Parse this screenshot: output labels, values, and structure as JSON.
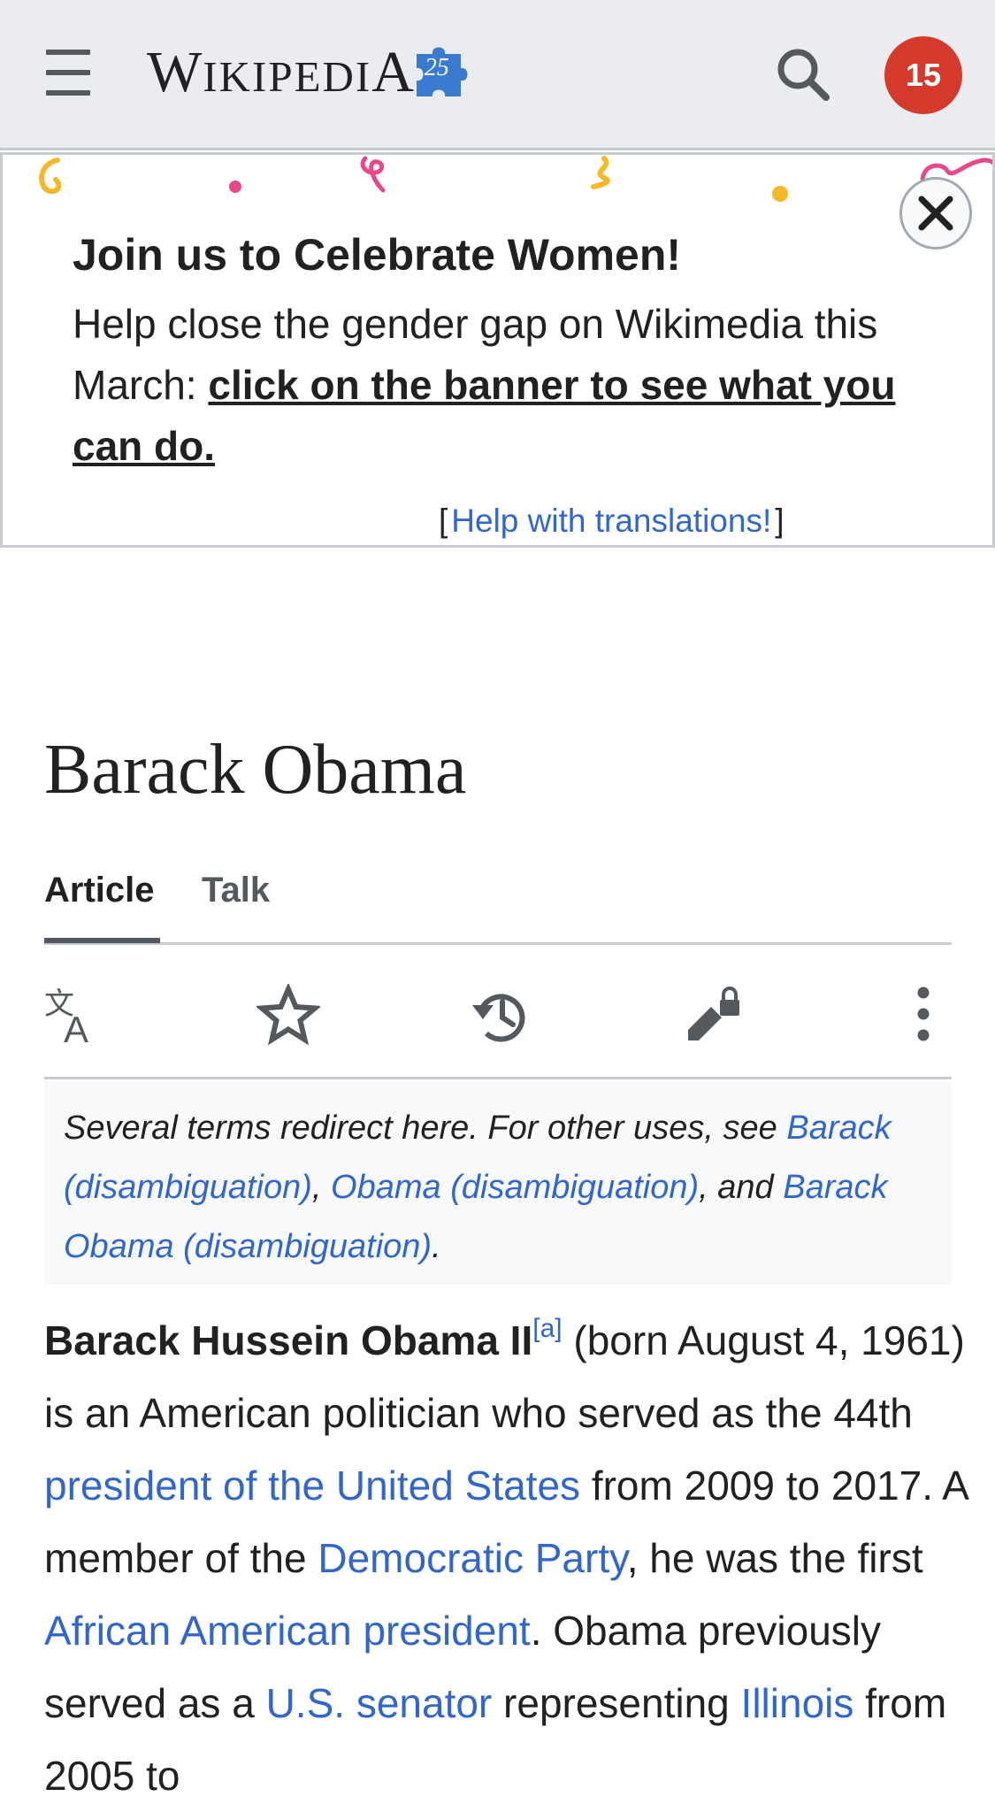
{
  "header": {
    "wordmark_initial": "W",
    "wordmark_rest": "IKIPEDI",
    "wordmark_final": "A",
    "anniversary_number": "25",
    "notification_count": "15"
  },
  "banner": {
    "title": "Join us to Celebrate Women!",
    "text": "Help close the gender gap on Wikimedia this March:",
    "link": "click on the banner to see what you can do.",
    "help_open": "[",
    "help_link": "Help with translations!",
    "help_close": "]"
  },
  "article": {
    "title": "Barack Obama",
    "tabs": [
      {
        "label": "Article",
        "selected": true
      },
      {
        "label": "Talk",
        "selected": false
      }
    ],
    "toolbar_icons": [
      "language-icon",
      "watch-star-icon",
      "history-icon",
      "edit-lock-icon",
      "more-icon"
    ],
    "hatnote": {
      "lead": "Several terms redirect here. For other uses, see",
      "link1": "Barack (disambiguation)",
      "sep1": ",",
      "link2": "Obama (disambiguation)",
      "sep2": ",",
      "and": "and",
      "link3": "Barack Obama (disambiguation)",
      "end": "."
    },
    "lead": {
      "name": "Barack Hussein Obama II",
      "footnote": "[a]",
      "t1": "(born August 4, 1961) is an American politician who served as the 44th",
      "l1": "president of the United States",
      "t2": "from 2009 to 2017. A member of the",
      "l2": "Democratic Party",
      "t3": ", he was the first",
      "l3": "African American president",
      "t4": ". Obama previously served as a",
      "l4": "U.S. senator",
      "t5": "representing",
      "l5": "Illinois",
      "t6": "from 2005 to"
    }
  },
  "colors": {
    "link": "#3366cc",
    "text": "#202122",
    "header_bg": "#eaecf0",
    "badge": "#d33a2c",
    "hatnote_bg": "#f8f9fa",
    "puzzle": "#3a7bd0"
  }
}
